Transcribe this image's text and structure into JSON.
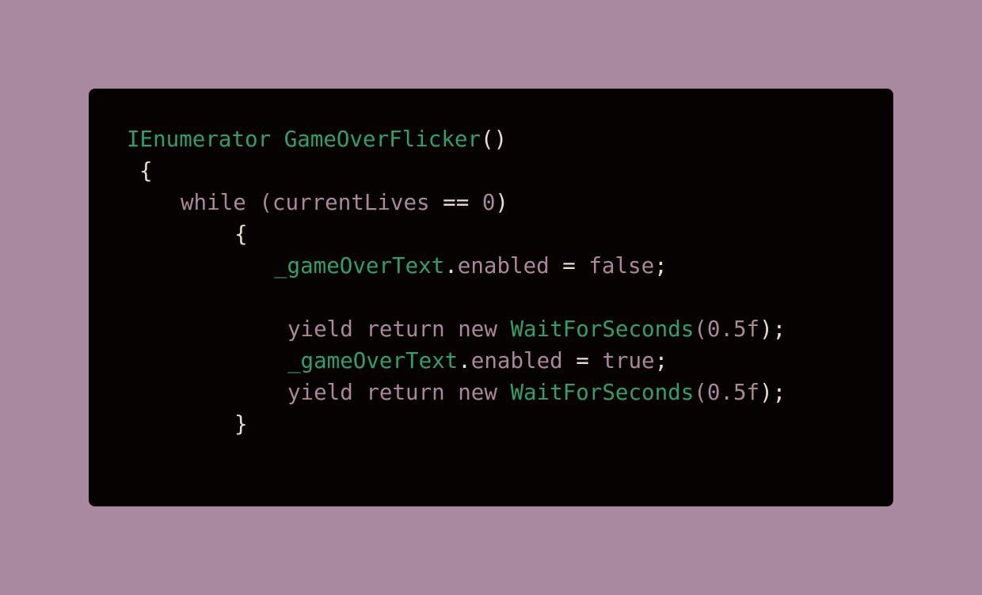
{
  "code": {
    "lines": [
      {
        "tokens": [
          {
            "text": "IEnumerator",
            "kind": "type"
          },
          {
            "text": " ",
            "kind": "punc"
          },
          {
            "text": "GameOverFlicker",
            "kind": "type"
          },
          {
            "text": "()",
            "kind": "punc"
          }
        ]
      },
      {
        "tokens": [
          {
            "text": "{",
            "kind": "punc"
          }
        ]
      },
      {
        "tokens": [
          {
            "text": "while",
            "kind": "kw"
          },
          {
            "text": " ",
            "kind": "punc"
          },
          {
            "text": "(",
            "kind": "kw"
          },
          {
            "text": "currentLives",
            "kind": "ident"
          },
          {
            "text": " == ",
            "kind": "punc"
          },
          {
            "text": "0",
            "kind": "num"
          },
          {
            "text": ")",
            "kind": "punc"
          }
        ]
      },
      {
        "tokens": [
          {
            "text": "{",
            "kind": "punc"
          }
        ]
      },
      {
        "tokens": [
          {
            "text": "_gameOverText",
            "kind": "type"
          },
          {
            "text": ".",
            "kind": "punc"
          },
          {
            "text": "enabled",
            "kind": "ident"
          },
          {
            "text": " = ",
            "kind": "punc"
          },
          {
            "text": "false",
            "kind": "kw"
          },
          {
            "text": ";",
            "kind": "punc"
          }
        ]
      },
      {
        "tokens": [
          {
            "text": "yield return new",
            "kind": "kw"
          },
          {
            "text": " ",
            "kind": "punc"
          },
          {
            "text": "WaitForSeconds",
            "kind": "type"
          },
          {
            "text": "(",
            "kind": "kw"
          },
          {
            "text": "0.5f",
            "kind": "num"
          },
          {
            "text": ");",
            "kind": "punc"
          }
        ]
      },
      {
        "tokens": [
          {
            "text": "_gameOverText",
            "kind": "type"
          },
          {
            "text": ".",
            "kind": "punc"
          },
          {
            "text": "enabled",
            "kind": "ident"
          },
          {
            "text": " = ",
            "kind": "punc"
          },
          {
            "text": "true",
            "kind": "kw"
          },
          {
            "text": ";",
            "kind": "punc"
          }
        ]
      },
      {
        "tokens": [
          {
            "text": "yield return new",
            "kind": "kw"
          },
          {
            "text": " ",
            "kind": "punc"
          },
          {
            "text": "WaitForSeconds",
            "kind": "type"
          },
          {
            "text": "(",
            "kind": "kw"
          },
          {
            "text": "0.5f",
            "kind": "num"
          },
          {
            "text": ");",
            "kind": "punc"
          }
        ]
      },
      {
        "tokens": [
          {
            "text": "}",
            "kind": "punc"
          }
        ]
      }
    ]
  },
  "colors": {
    "page_background": "#a9899f",
    "card_background": "#070202",
    "type_green": "#2fa06a",
    "keyword_mauve": "#a8889a",
    "plain_text": "#e8dcd0"
  }
}
